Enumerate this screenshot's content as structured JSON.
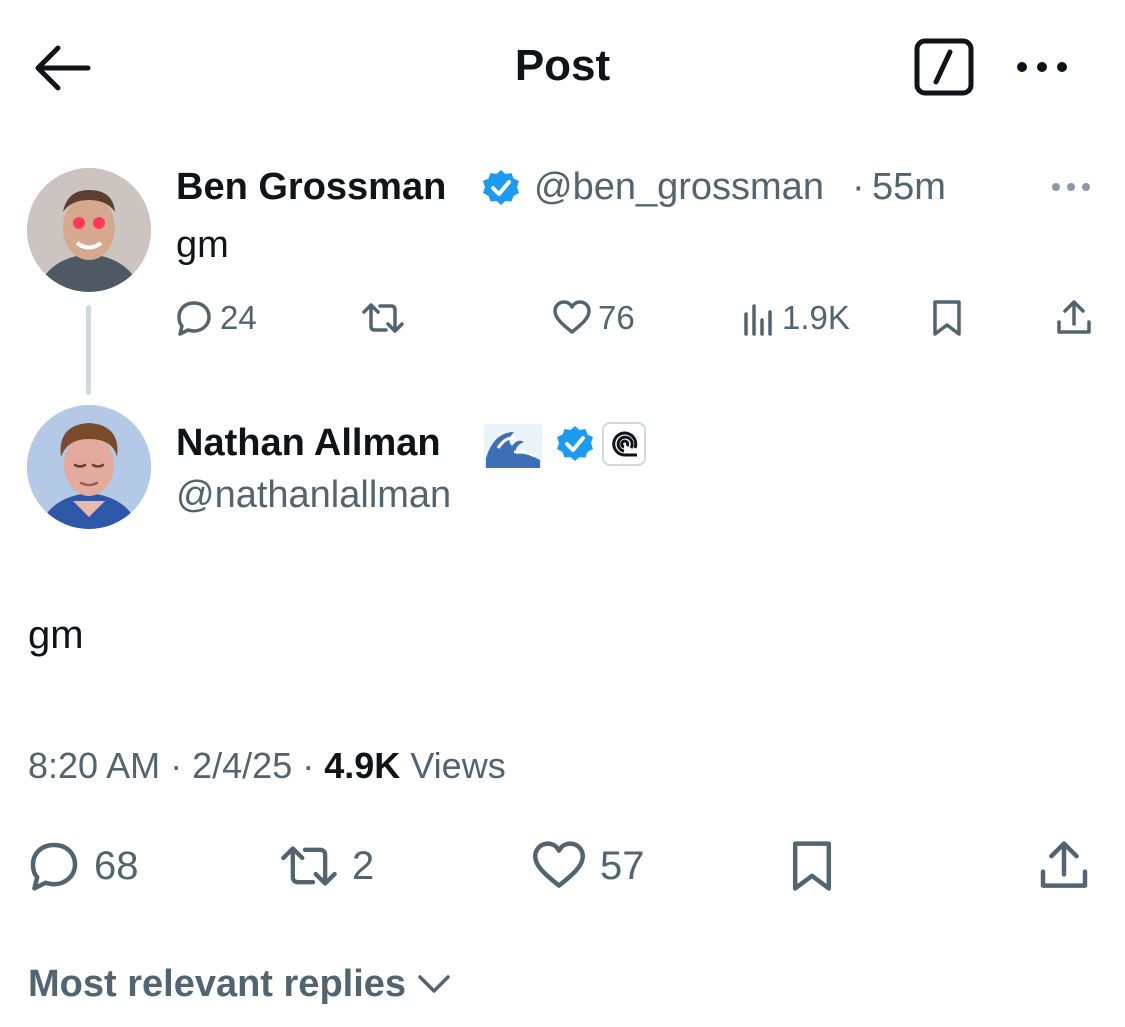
{
  "header": {
    "title": "Post"
  },
  "parent_tweet": {
    "author_name": "Ben Grossman",
    "handle": "@ben_grossman",
    "separator": "·",
    "time": "55m",
    "text": "gm",
    "stats": {
      "replies": "24",
      "likes": "76",
      "views": "1.9K"
    }
  },
  "main_tweet": {
    "author_name": "Nathan Allman",
    "name_emoji": "wave-emoji",
    "handle": "@nathanlallman",
    "text": "gm",
    "time": "8:20 AM",
    "date": "2/4/25",
    "separator": "·",
    "views_count": "4.9K",
    "views_label": "Views",
    "stats": {
      "replies": "68",
      "reposts": "2",
      "likes": "57"
    }
  },
  "replies_sort": {
    "label": "Most relevant replies"
  },
  "colors": {
    "verified": "#1d9bf0",
    "secondary_text": "#536471",
    "primary_text": "#0f1419",
    "thread_line": "#cfd9de"
  }
}
